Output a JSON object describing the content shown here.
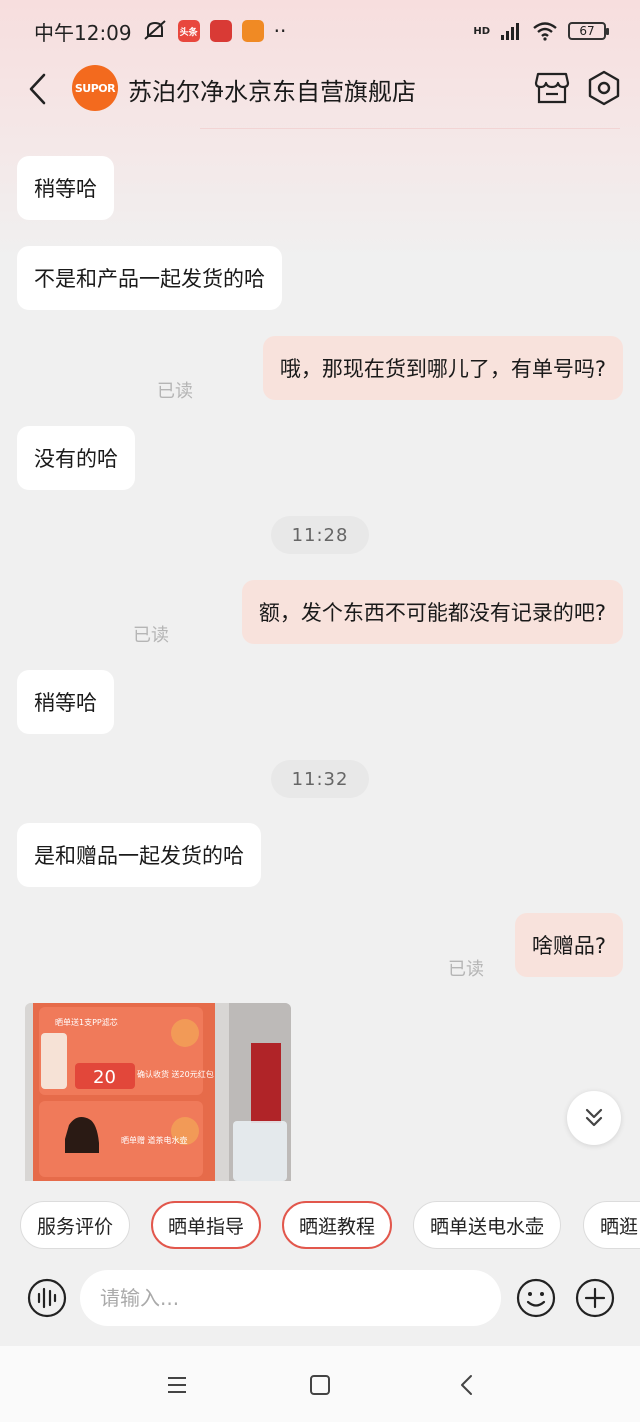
{
  "status_bar": {
    "time": "中午12:09",
    "signal": "HD",
    "battery": "67",
    "app_badges": [
      {
        "text": "头条",
        "color": "#e8473d"
      },
      {
        "text": "",
        "color": "#d93a35"
      },
      {
        "text": "",
        "color": "#f08a24"
      }
    ],
    "more": "··"
  },
  "header": {
    "logo_text": "SUPOR",
    "shop_name": "苏泊尔净水京东自营旗舰店"
  },
  "messages": [
    {
      "side": "left",
      "text": "稍等哈"
    },
    {
      "side": "left",
      "text": "不是和产品一起发货的哈"
    },
    {
      "side": "right",
      "text": "哦，那现在货到哪儿了，有单号吗?",
      "read": "已读"
    },
    {
      "side": "left",
      "text": "没有的哈"
    },
    {
      "timestamp": "11:28"
    },
    {
      "side": "right",
      "text": "额，发个东西不可能都没有记录的吧?",
      "read": "已读"
    },
    {
      "side": "left",
      "text": "稍等哈"
    },
    {
      "timestamp": "11:32"
    },
    {
      "side": "left",
      "text": "是和赠品一起发货的哈"
    },
    {
      "side": "right",
      "text": "啥赠品?",
      "read": "已读"
    }
  ],
  "image_card": {
    "banner_top": "晒单送1支PP滤芯",
    "amount": "20",
    "confirm_text": "确认收货 送20元红包",
    "banner_bottom": "晒单赠 道茶电水壶"
  },
  "quick_replies": [
    {
      "label": "服务评价",
      "highlight": false
    },
    {
      "label": "晒单指导",
      "highlight": true
    },
    {
      "label": "晒逛教程",
      "highlight": true
    },
    {
      "label": "晒单送电水壶",
      "highlight": false
    },
    {
      "label": "晒逛",
      "highlight": false
    }
  ],
  "input": {
    "placeholder": "请输入..."
  },
  "colors": {
    "brand_orange": "#f36a1e",
    "right_bubble": "#f8e2dc",
    "chip_highlight": "#e2574c"
  }
}
